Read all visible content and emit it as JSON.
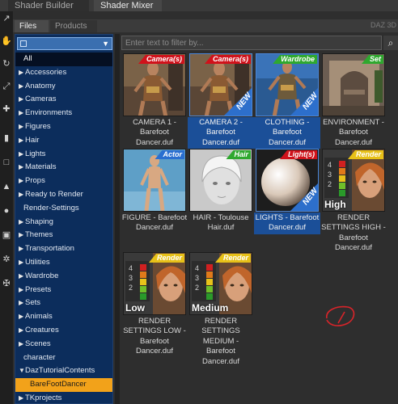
{
  "window": {
    "tabs": [
      {
        "label": "Shader Builder"
      },
      {
        "label": "Shader Mixer"
      }
    ]
  },
  "panel": {
    "tabs": [
      {
        "label": "Files"
      },
      {
        "label": "Products"
      }
    ],
    "corner_label": "DAZ 3D"
  },
  "tree": {
    "items": [
      {
        "label": "All",
        "kind": "all"
      },
      {
        "label": "Accessories",
        "kind": "collapsed"
      },
      {
        "label": "Anatomy",
        "kind": "collapsed"
      },
      {
        "label": "Cameras",
        "kind": "collapsed"
      },
      {
        "label": "Environments",
        "kind": "collapsed"
      },
      {
        "label": "Figures",
        "kind": "collapsed"
      },
      {
        "label": "Hair",
        "kind": "collapsed"
      },
      {
        "label": "Lights",
        "kind": "collapsed"
      },
      {
        "label": "Materials",
        "kind": "collapsed"
      },
      {
        "label": "Props",
        "kind": "collapsed"
      },
      {
        "label": "Ready to Render",
        "kind": "collapsed"
      },
      {
        "label": "Render-Settings",
        "kind": "leaf"
      },
      {
        "label": "Shaping",
        "kind": "collapsed"
      },
      {
        "label": "Themes",
        "kind": "collapsed"
      },
      {
        "label": "Transportation",
        "kind": "collapsed"
      },
      {
        "label": "Utilities",
        "kind": "collapsed"
      },
      {
        "label": "Wardrobe",
        "kind": "collapsed"
      },
      {
        "label": "Presets",
        "kind": "collapsed"
      },
      {
        "label": "Sets",
        "kind": "collapsed"
      },
      {
        "label": "Animals",
        "kind": "collapsed"
      },
      {
        "label": "Creatures",
        "kind": "collapsed"
      },
      {
        "label": "Scenes",
        "kind": "collapsed"
      },
      {
        "label": "character",
        "kind": "leaf"
      },
      {
        "label": "DazTutorialContents",
        "kind": "expanded"
      },
      {
        "label": "BareFootDancer",
        "kind": "selected"
      },
      {
        "label": "TKprojects",
        "kind": "collapsed"
      }
    ]
  },
  "filter": {
    "placeholder": "Enter text to filter by..."
  },
  "cards": [
    {
      "label": "CAMERA 1 - Barefoot Dancer.duf",
      "badge": "Camera(s)",
      "badge_color": "#d0121b",
      "is_new": false,
      "selected": false,
      "art": "dancer"
    },
    {
      "label": "CAMERA 2 - Barefoot Dancer.duf",
      "badge": "Camera(s)",
      "badge_color": "#d0121b",
      "is_new": true,
      "new_text": "NEW",
      "selected": true,
      "art": "dancer"
    },
    {
      "label": "CLOTHING - Barefoot Dancer.duf",
      "badge": "Wardrobe",
      "badge_color": "#2fa82f",
      "is_new": true,
      "new_text": "NEW",
      "selected": true,
      "art": "dancer-blue"
    },
    {
      "label": "ENVIRONMENT - Barefoot Dancer.duf",
      "badge": "Set",
      "badge_color": "#2fa82f",
      "is_new": false,
      "selected": false,
      "art": "env"
    },
    {
      "label": "FIGURE - Barefoot Dancer.duf",
      "badge": "Actor",
      "badge_color": "#2a6fd0",
      "is_new": false,
      "selected": false,
      "art": "figure"
    },
    {
      "label": "HAIR - Toulouse Hair.duf",
      "badge": "Hair",
      "badge_color": "#2fa82f",
      "is_new": false,
      "selected": false,
      "art": "hair"
    },
    {
      "label": "LIGHTS - Barefoot Dancer.duf",
      "badge": "Light(s)",
      "badge_color": "#d0121b",
      "is_new": true,
      "new_text": "NEW",
      "selected": true,
      "art": "sphere"
    },
    {
      "label": "RENDER SETTINGS HIGH - Barefoot Dancer.duf",
      "badge": "Render",
      "badge_color": "#e7c118",
      "is_new": false,
      "selected": false,
      "art": "render",
      "level": "High"
    },
    {
      "label": "RENDER SETTINGS LOW - Barefoot Dancer.duf",
      "badge": "Render",
      "badge_color": "#e7c118",
      "is_new": false,
      "selected": false,
      "art": "render",
      "level": "Low"
    },
    {
      "label": "RENDER SETTINGS MEDIUM - Barefoot Dancer.duf",
      "badge": "Render",
      "badge_color": "#e7c118",
      "is_new": false,
      "selected": false,
      "art": "render",
      "level": "Medium"
    }
  ],
  "colors": {
    "tree_bg": "#0c2d5c",
    "selected_item": "#f2a21a",
    "selected_card": "#1b4f98"
  }
}
